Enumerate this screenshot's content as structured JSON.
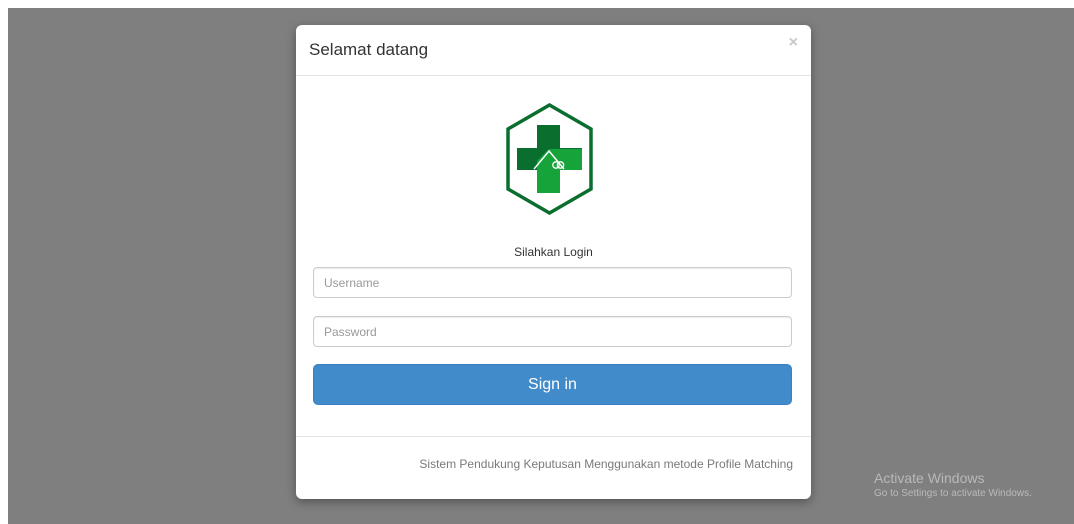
{
  "modal": {
    "title": "Selamat datang",
    "close_symbol": "×",
    "logo_icon": "health-cross-hexagon-icon",
    "login_label": "Silahkan Login",
    "username_placeholder": "Username",
    "password_placeholder": "Password",
    "signin_label": "Sign in",
    "footer_text": "Sistem Pendukung Keputusan Menggunakan metode Profile Matching"
  },
  "watermark": {
    "title": "Activate Windows",
    "subtitle": "Go to Settings to activate Windows."
  },
  "colors": {
    "backdrop": "#7f7f7f",
    "primary_button": "#428bca",
    "logo_dark_green": "#0a6e2e",
    "logo_light_green": "#16a33a"
  }
}
